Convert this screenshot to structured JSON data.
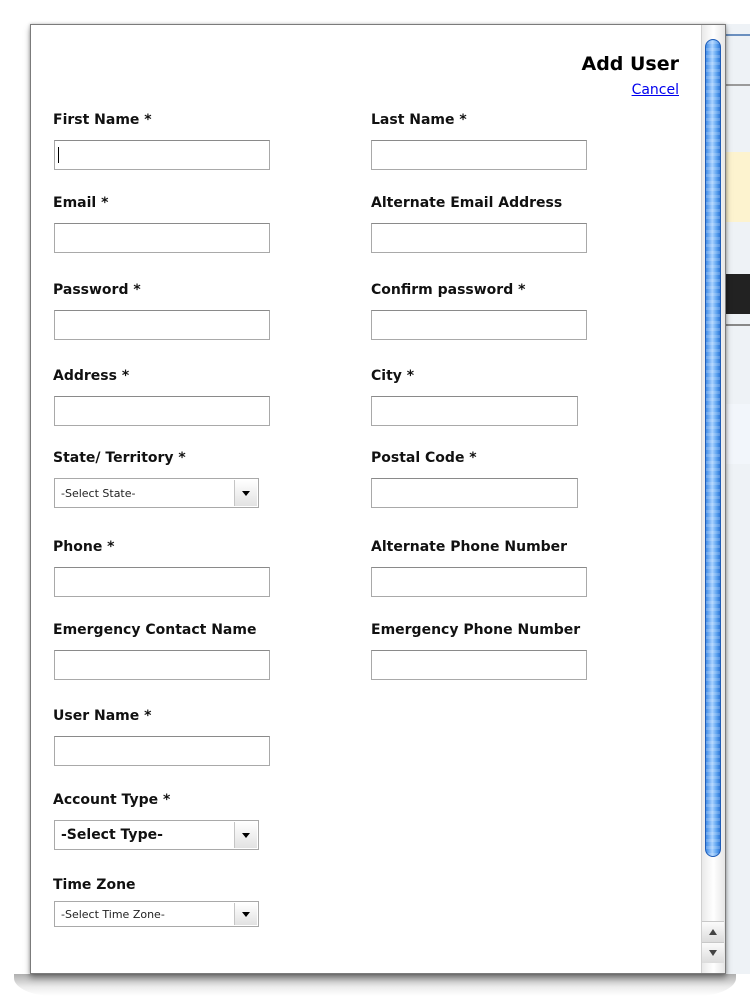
{
  "dialog": {
    "title": "Add User",
    "cancel_label": "Cancel"
  },
  "form": {
    "first_name": {
      "label": "First Name *",
      "value": ""
    },
    "last_name": {
      "label": "Last Name *",
      "value": ""
    },
    "email": {
      "label": "Email *",
      "value": ""
    },
    "alt_email": {
      "label": "Alternate Email Address",
      "value": ""
    },
    "password": {
      "label": "Password *",
      "value": ""
    },
    "confirm_password": {
      "label": "Confirm password *",
      "value": ""
    },
    "address": {
      "label": "Address *",
      "value": ""
    },
    "city": {
      "label": "City *",
      "value": ""
    },
    "state": {
      "label": "State/ Territory *",
      "selected": "-Select State-"
    },
    "postal_code": {
      "label": "Postal Code *",
      "value": ""
    },
    "phone": {
      "label": "Phone *",
      "value": ""
    },
    "alt_phone": {
      "label": "Alternate Phone Number",
      "value": ""
    },
    "emergency_name": {
      "label": "Emergency Contact Name",
      "value": ""
    },
    "emergency_phone": {
      "label": "Emergency Phone Number",
      "value": ""
    },
    "username": {
      "label": "User Name *",
      "value": ""
    },
    "account_type": {
      "label": "Account Type *",
      "selected": "-Select Type-"
    },
    "time_zone": {
      "label": "Time Zone",
      "selected": "-Select Time Zone-"
    }
  },
  "icons": {
    "dropdown": "chevron-down-icon",
    "scroll_up": "arrow-up-icon",
    "scroll_down": "arrow-down-icon"
  },
  "colors": {
    "link": "#0000ee",
    "scroll_thumb": "#5ea4f0"
  }
}
